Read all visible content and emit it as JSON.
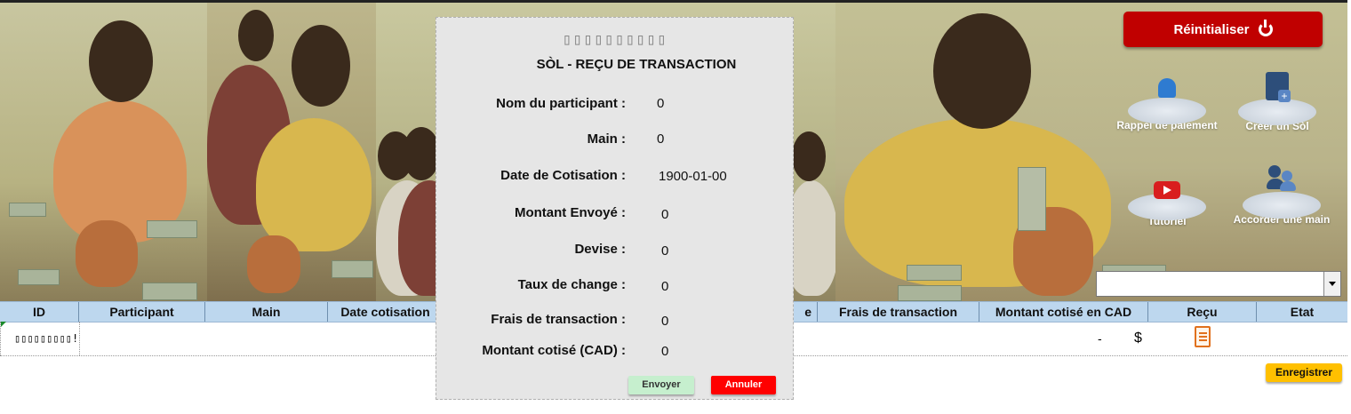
{
  "banner": {
    "reset_label": "Réinitialiser",
    "actions": [
      {
        "label": "Rappel de paiement",
        "icon": "bell-icon"
      },
      {
        "label": "Créer un Sòl",
        "icon": "new-document-icon"
      },
      {
        "label": "Tutoriel",
        "icon": "youtube-play-icon"
      },
      {
        "label": "Accorder une main",
        "icon": "people-icon"
      }
    ],
    "dropdown_value": ""
  },
  "table": {
    "headers": [
      "ID",
      "Participant",
      "Main",
      "Date cotisation",
      "e",
      "Frais de transaction",
      "Montant cotisé en CAD",
      "Reçu",
      "Etat"
    ],
    "row": {
      "id": "▯▯▯▯▯▯▯▯▯!",
      "dash": "-",
      "currency": "$"
    }
  },
  "save_label": "Enregistrer",
  "dialog": {
    "glyphs": "▯▯▯▯▯▯▯▯▯▯",
    "title": "SÒL - REÇU DE TRANSACTION",
    "fields": [
      {
        "label": "Nom du participant :",
        "value": "0"
      },
      {
        "label": "Main :",
        "value": "0"
      },
      {
        "label": "Date de Cotisation :",
        "value": "1900-01-00"
      },
      {
        "label": "Montant Envoyé :",
        "value": "0"
      },
      {
        "label": "Devise :",
        "value": "0"
      },
      {
        "label": "Taux de change :",
        "value": "0"
      },
      {
        "label": "Frais de transaction :",
        "value": "0"
      },
      {
        "label": "Montant cotisé (CAD) :",
        "value": "0"
      }
    ],
    "send_label": "Envoyer",
    "cancel_label": "Annuler"
  },
  "colors": {
    "reset": "#c00000",
    "header": "#bdd7ee",
    "save": "#ffc000",
    "send": "#c6efce",
    "cancel": "#ff0000"
  }
}
